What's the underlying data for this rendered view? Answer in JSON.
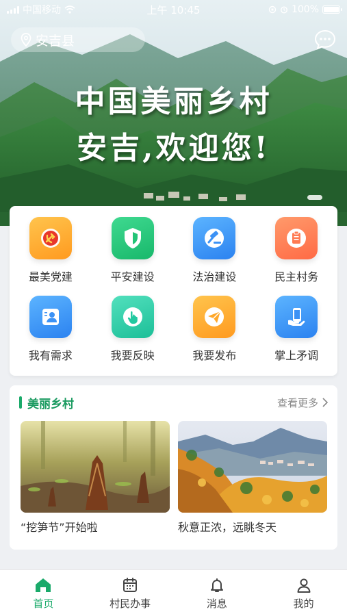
{
  "status_bar": {
    "carrier": "中国移动",
    "time": "上午 10:45",
    "battery": "100%",
    "battery_level": 1.0
  },
  "header": {
    "location": "安吉县",
    "hero_line1": "中国美丽乡村",
    "hero_line2": "安吉,欢迎您!"
  },
  "grid": [
    {
      "label": "最美党建",
      "icon": "party-emblem-icon",
      "color": "#ffa82a"
    },
    {
      "label": "平安建设",
      "icon": "shield-icon",
      "color": "#22c476"
    },
    {
      "label": "法治建设",
      "icon": "gavel-icon",
      "color": "#3c92f5"
    },
    {
      "label": "民主村务",
      "icon": "clipboard-icon",
      "color": "#ff7a52"
    },
    {
      "label": "我有需求",
      "icon": "person-card-icon",
      "color": "#3c92f5"
    },
    {
      "label": "我要反映",
      "icon": "hand-tap-icon",
      "color": "#22c9a0"
    },
    {
      "label": "我要发布",
      "icon": "paper-plane-icon",
      "color": "#ffa82a"
    },
    {
      "label": "掌上矛调",
      "icon": "phone-hand-icon",
      "color": "#3c92f5"
    }
  ],
  "beauty": {
    "title": "美丽乡村",
    "more": "查看更多",
    "items": [
      {
        "caption": "“挖笋节”开始啦"
      },
      {
        "caption": "秋意正浓，远眺冬天"
      }
    ]
  },
  "tabs": [
    {
      "label": "首页",
      "icon": "home-icon",
      "active": true
    },
    {
      "label": "村民办事",
      "icon": "calendar-icon",
      "active": false
    },
    {
      "label": "消息",
      "icon": "bell-icon",
      "active": false
    },
    {
      "label": "我的",
      "icon": "user-icon",
      "active": false
    }
  ],
  "colors": {
    "accent": "#1aaa6a"
  }
}
